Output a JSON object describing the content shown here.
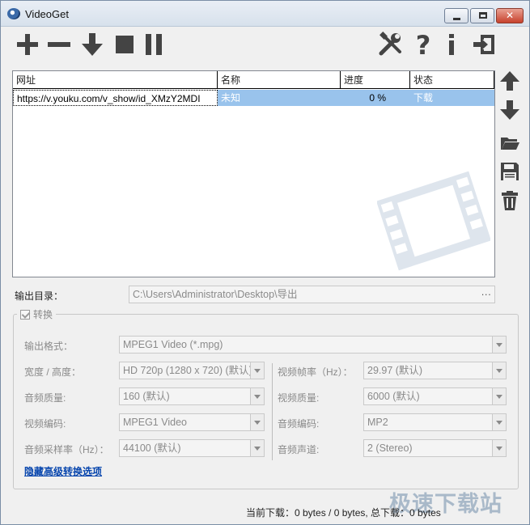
{
  "window": {
    "title": "VideoGet"
  },
  "toolbar": {
    "add_icon": "plus-icon",
    "remove_icon": "minus-icon",
    "download_icon": "arrow-down-icon",
    "stop_icon": "stop-icon",
    "pause_icon": "pause-icon",
    "settings_icon": "tools-icon",
    "help_icon": "question-icon",
    "info_icon": "info-icon",
    "exit_icon": "exit-icon"
  },
  "list": {
    "columns": [
      "网址",
      "名称",
      "进度",
      "状态"
    ],
    "rows": [
      {
        "url": "https://v.youku.com/v_show/id_XMzY2MDI",
        "name": "未知",
        "progress": "0 %",
        "status": "下载"
      }
    ]
  },
  "side": {
    "icons": [
      "arrow-up-icon",
      "arrow-down-icon",
      "folder-icon",
      "save-icon",
      "trash-icon"
    ]
  },
  "output": {
    "label": "输出目录：",
    "path": "C:\\Users\\Administrator\\Desktop\\导出",
    "browse": "···"
  },
  "convert": {
    "legend": "转换",
    "checked": true,
    "format_label": "输出格式：",
    "format_value": "MPEG1 Video (*.mpg)",
    "size_label": "宽度 / 高度：",
    "size_value": "HD 720p (1280 x 720) (默认)",
    "framerate_label": "视频帧率（Hz）：",
    "framerate_value": "29.97 (默认)",
    "audio_quality_label": "音频质量:",
    "audio_quality_value": "160 (默认)",
    "video_quality_label": "视频质量:",
    "video_quality_value": "6000 (默认)",
    "video_codec_label": "视频编码:",
    "video_codec_value": "MPEG1 Video",
    "audio_codec_label": "音频编码:",
    "audio_codec_value": "MP2",
    "sample_rate_label": "音频采样率（Hz）：",
    "sample_rate_value": "44100 (默认)",
    "channels_label": "音频声道:",
    "channels_value": "2 (Stereo)",
    "hide_link": "隐藏高级转换选项"
  },
  "status": {
    "text": "当前下载：0 bytes / 0 bytes, 总下载：0 bytes"
  },
  "watermark": {
    "text": "极速下载站"
  },
  "colors": {
    "selection": "#99c3ec",
    "link": "#0645ad",
    "disabled_text": "#8a8a8a"
  }
}
